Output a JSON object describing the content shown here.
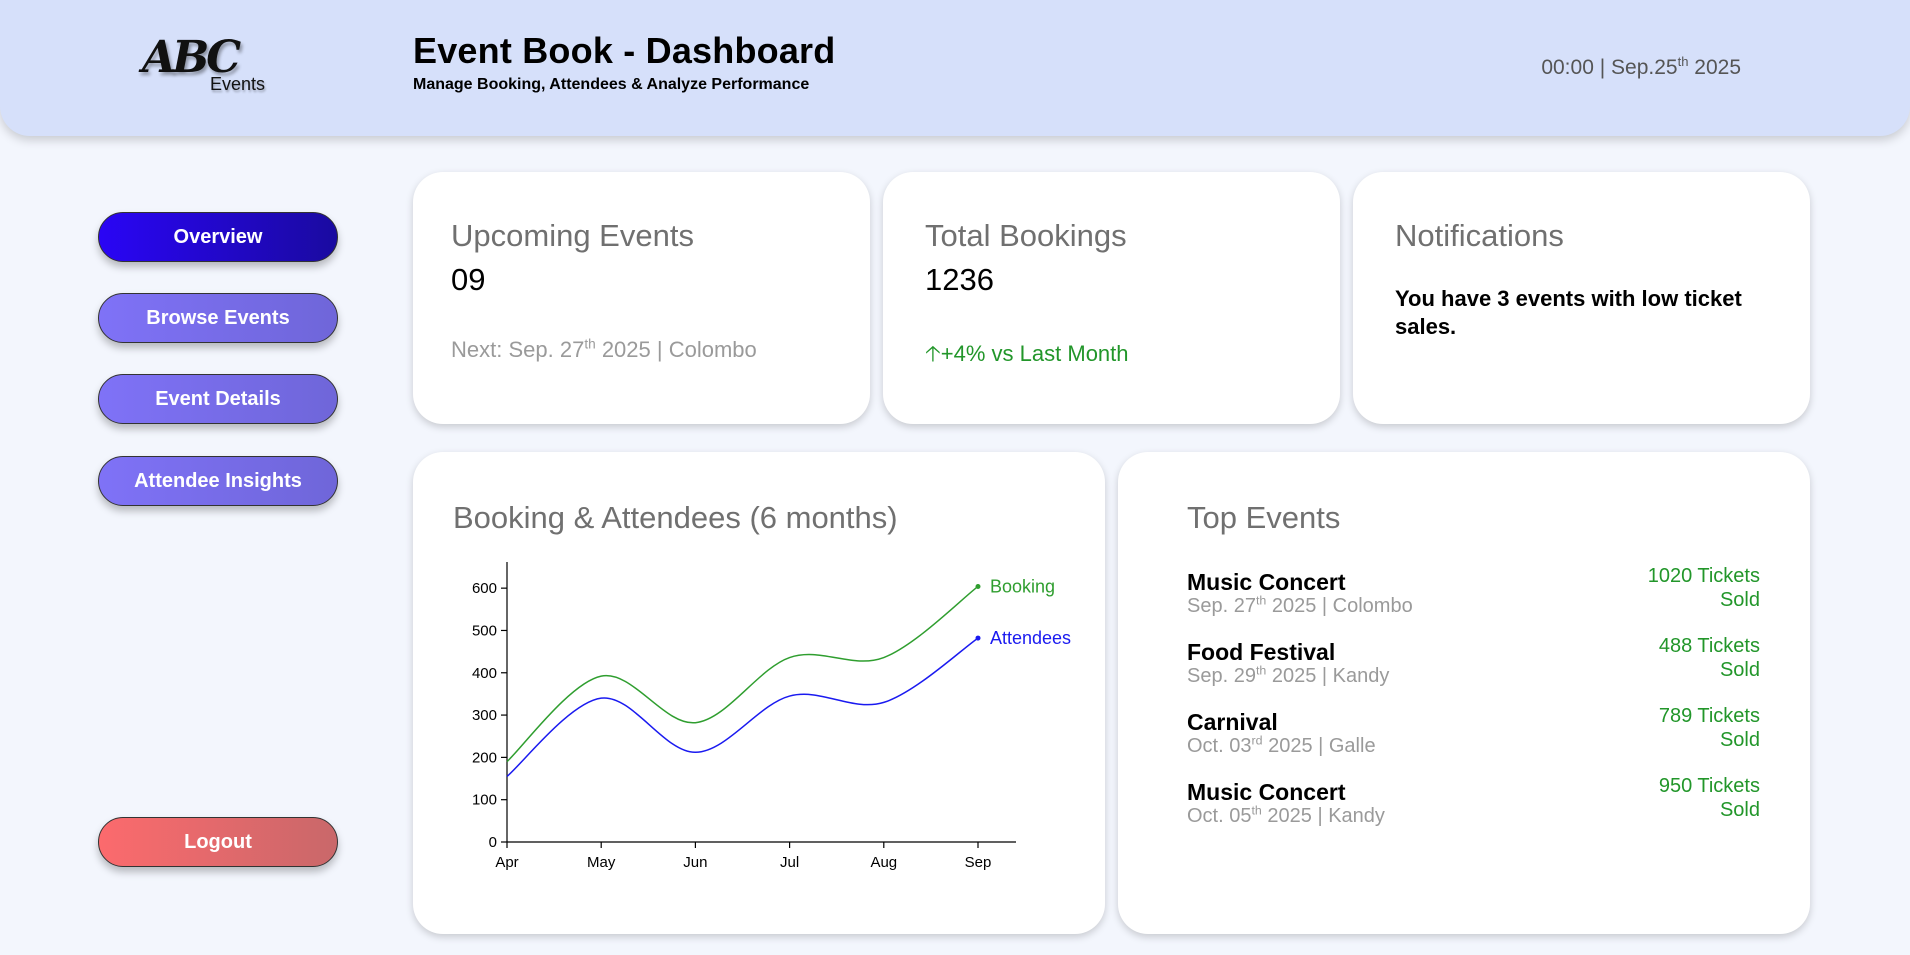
{
  "header": {
    "logo_mark": "ABC",
    "logo_sub": "Events",
    "title": "Event Book - Dashboard",
    "subtitle": "Manage Booking, Attendees & Analyze Performance",
    "time": "00:00",
    "date_prefix": "Sep.25",
    "date_sup": "th",
    "date_suffix": "2025"
  },
  "sidebar": {
    "items": [
      {
        "label": "Overview"
      },
      {
        "label": "Browse Events"
      },
      {
        "label": "Event Details"
      },
      {
        "label": "Attendee Insights"
      }
    ],
    "logout_label": "Logout"
  },
  "cards": {
    "upcoming": {
      "title": "Upcoming Events",
      "value": "09",
      "next_prefix": "Next: Sep. 27",
      "next_sup": "th",
      "next_suffix": "2025 | Colombo"
    },
    "bookings": {
      "title": "Total Bookings",
      "value": "1236",
      "change_arrow": "🡡",
      "change": "+4% vs Last Month"
    },
    "notifications": {
      "title": "Notifications",
      "message": "You have 3 events with low ticket sales."
    }
  },
  "chart_panel": {
    "title": "Booking & Attendees (6 months)"
  },
  "chart_data": {
    "type": "line",
    "categories": [
      "Apr",
      "May",
      "Jun",
      "Jul",
      "Aug",
      "Sep"
    ],
    "ylim": [
      0,
      650
    ],
    "yticks": [
      0,
      100,
      200,
      300,
      400,
      500,
      600
    ],
    "grid": false,
    "series": [
      {
        "name": "Booking",
        "color": "#2f9e2f",
        "values": [
          190,
          392,
          282,
          436,
          436,
          604
        ]
      },
      {
        "name": "Attendees",
        "color": "#1a1af0",
        "values": [
          155,
          340,
          212,
          345,
          330,
          482
        ]
      }
    ]
  },
  "top_events": {
    "title": "Top Events",
    "items": [
      {
        "name": "Music Concert",
        "date_prefix": "Sep. 27",
        "date_sup": "th",
        "date_suffix": "2025 | Colombo",
        "sold_line1": "1020 Tickets",
        "sold_line2": "Sold"
      },
      {
        "name": "Food Festival",
        "date_prefix": "Sep. 29",
        "date_sup": "th",
        "date_suffix": "2025 | Kandy",
        "sold_line1": "488 Tickets",
        "sold_line2": "Sold"
      },
      {
        "name": "Carnival",
        "date_prefix": "Oct. 03",
        "date_sup": "rd",
        "date_suffix": "2025 | Galle",
        "sold_line1": "789 Tickets",
        "sold_line2": "Sold"
      },
      {
        "name": "Music Concert",
        "date_prefix": "Oct. 05",
        "date_sup": "th",
        "date_suffix": "2025 | Kandy",
        "sold_line1": "950 Tickets",
        "sold_line2": "Sold"
      }
    ]
  }
}
